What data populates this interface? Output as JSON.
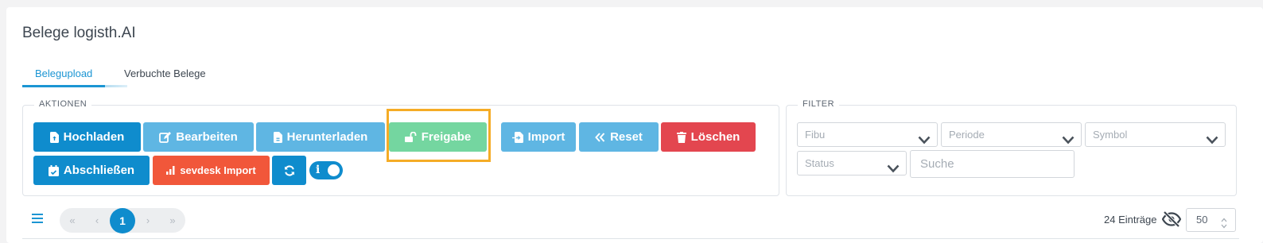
{
  "page": {
    "title": "Belege logisth.AI"
  },
  "tabs": [
    {
      "label": "Belegupload",
      "active": true
    },
    {
      "label": "Verbuchte Belege",
      "active": false
    }
  ],
  "aktionen": {
    "legend": "AKTIONEN",
    "buttons": {
      "hochladen": "Hochladen",
      "bearbeiten": "Bearbeiten",
      "herunterladen": "Herunterladen",
      "freigabe": "Freigabe",
      "import": "Import",
      "reset": "Reset",
      "loeschen": "Löschen",
      "abschliessen": "Abschließen",
      "sevdesk": "sevdesk Import"
    },
    "toggle_label": "i"
  },
  "filter": {
    "legend": "FILTER",
    "fibu": "Fibu",
    "periode": "Periode",
    "symbol": "Symbol",
    "status": "Status",
    "search_placeholder": "Suche"
  },
  "pagination": {
    "first": "«",
    "prev": "‹",
    "current": "1",
    "next": "›",
    "last": "»"
  },
  "entries": {
    "count_label": "24 Einträge",
    "per_page": "50"
  },
  "colors": {
    "primary": "#0f8ccd",
    "light_primary": "#5fb6e3",
    "green": "#74d6a0",
    "red": "#e3464f",
    "orange": "#f1573a",
    "highlight": "#f5ac26"
  }
}
